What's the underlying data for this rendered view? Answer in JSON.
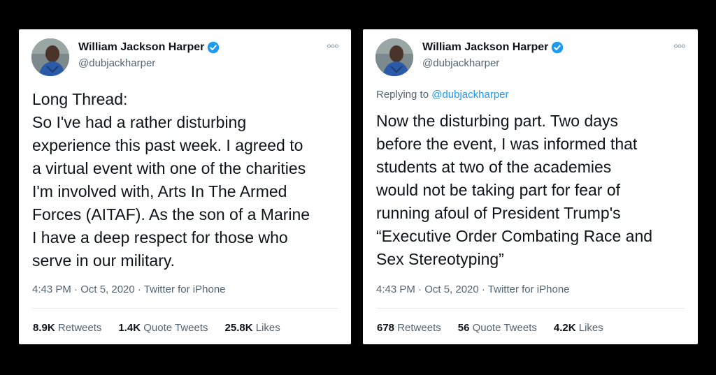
{
  "colors": {
    "background": "#000000",
    "card": "#ffffff",
    "verified_badge": "#1d9bf0",
    "secondary_text": "#536471",
    "mention": "#1d9bf0"
  },
  "tweets": [
    {
      "author": {
        "name": "William Jackson Harper",
        "handle": "@dubjackharper",
        "verified_icon": "verified-badge-icon"
      },
      "more_icon": "more-options-icon",
      "replying_label": "",
      "replying_to": "",
      "lines": [
        "Long Thread:",
        "So I've had a rather disturbing",
        "experience this past week.  I agreed to",
        "a virtual event with one of the charities",
        "I'm involved with, Arts In The Armed",
        "Forces (AITAF). As the son of a Marine",
        "I have a deep respect for those who",
        "serve in our military."
      ],
      "meta": "4:43 PM · Oct 5, 2020 · Twitter for iPhone",
      "stats": [
        {
          "count": "8.9K",
          "label": "Retweets"
        },
        {
          "count": "1.4K",
          "label": "Quote Tweets"
        },
        {
          "count": "25.8K",
          "label": "Likes"
        }
      ]
    },
    {
      "author": {
        "name": "William Jackson Harper",
        "handle": "@dubjackharper",
        "verified_icon": "verified-badge-icon"
      },
      "more_icon": "more-options-icon",
      "replying_label": "Replying to",
      "replying_to": "@dubjackharper",
      "lines": [
        "Now the disturbing part.  Two days",
        "before the event, I was informed that",
        "students at two of the academies",
        "would not be taking part for fear of",
        "running afoul of President Trump's",
        "“Executive Order Combating Race and",
        "Sex Stereotyping”"
      ],
      "meta": "4:43 PM · Oct 5, 2020 · Twitter for iPhone",
      "stats": [
        {
          "count": "678",
          "label": "Retweets"
        },
        {
          "count": "56",
          "label": "Quote Tweets"
        },
        {
          "count": "4.2K",
          "label": "Likes"
        }
      ]
    }
  ]
}
